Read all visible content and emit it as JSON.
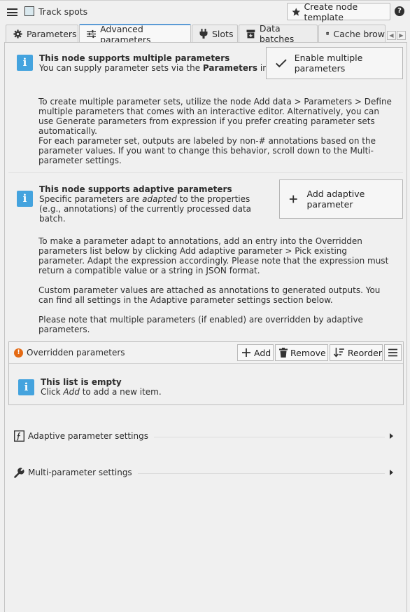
{
  "header": {
    "node_name": "Track spots",
    "create_template_label": "Create node template",
    "help": "?"
  },
  "tabs": [
    {
      "label": "Parameters",
      "icon": "gear-icon"
    },
    {
      "label": "Advanced parameters",
      "icon": "sliders-icon",
      "active": true
    },
    {
      "label": "Slots",
      "icon": "plug-icon"
    },
    {
      "label": "Data batches",
      "icon": "archive-icon"
    },
    {
      "label": "Cache brow",
      "icon": "database-icon"
    }
  ],
  "multi": {
    "title": "This node supports multiple parameters",
    "subtitle_pre": "You can supply parameter sets via the ",
    "subtitle_bold": "Parameters",
    "subtitle_post": " input.",
    "button": "Enable multiple parameters",
    "para1": "To create multiple parameter sets, utilize the node Add data > Parameters > Define multiple parameters that comes with an interactive editor. Alternatively, you can use Generate parameters from expression if you prefer creating parameter sets automatically.",
    "para2": "For each parameter set, outputs are labeled by non-# annotations based on the parameter values. If you want to change this behavior, scroll down to the Multi-parameter settings."
  },
  "adaptive": {
    "title": "This node supports adaptive parameters",
    "subtitle_pre": "Specific parameters are ",
    "subtitle_italic": "adapted",
    "subtitle_post": " to the properties (e.g., annotations) of the currently processed data batch.",
    "button": "Add adaptive parameter",
    "para1": "To make a parameter adapt to annotations, add an entry into the Overridden parameters list below by clicking Add adaptive parameter > Pick existing parameter. Adapt the expression accordingly. Please note that the expression must return a compatible value or a string in JSON format.",
    "para2": "Custom parameter values are attached as annotations to generated outputs. You can find all settings in the Adaptive parameter settings section below.",
    "para3": "Please note that multiple parameters (if enabled) are overridden by adaptive parameters."
  },
  "overridden": {
    "title": "Overridden parameters",
    "add": "Add",
    "remove": "Remove",
    "reorder": "Reorder",
    "empty_title": "This list is empty",
    "empty_pre": "Click ",
    "empty_italic": "Add",
    "empty_post": " to add a new item."
  },
  "sections": {
    "adaptive_settings": "Adaptive parameter settings",
    "multi_settings": "Multi-parameter settings"
  },
  "colors": {
    "info": "#44a3de",
    "warning": "#e46a14",
    "tab_accent": "#5b9bd5"
  }
}
